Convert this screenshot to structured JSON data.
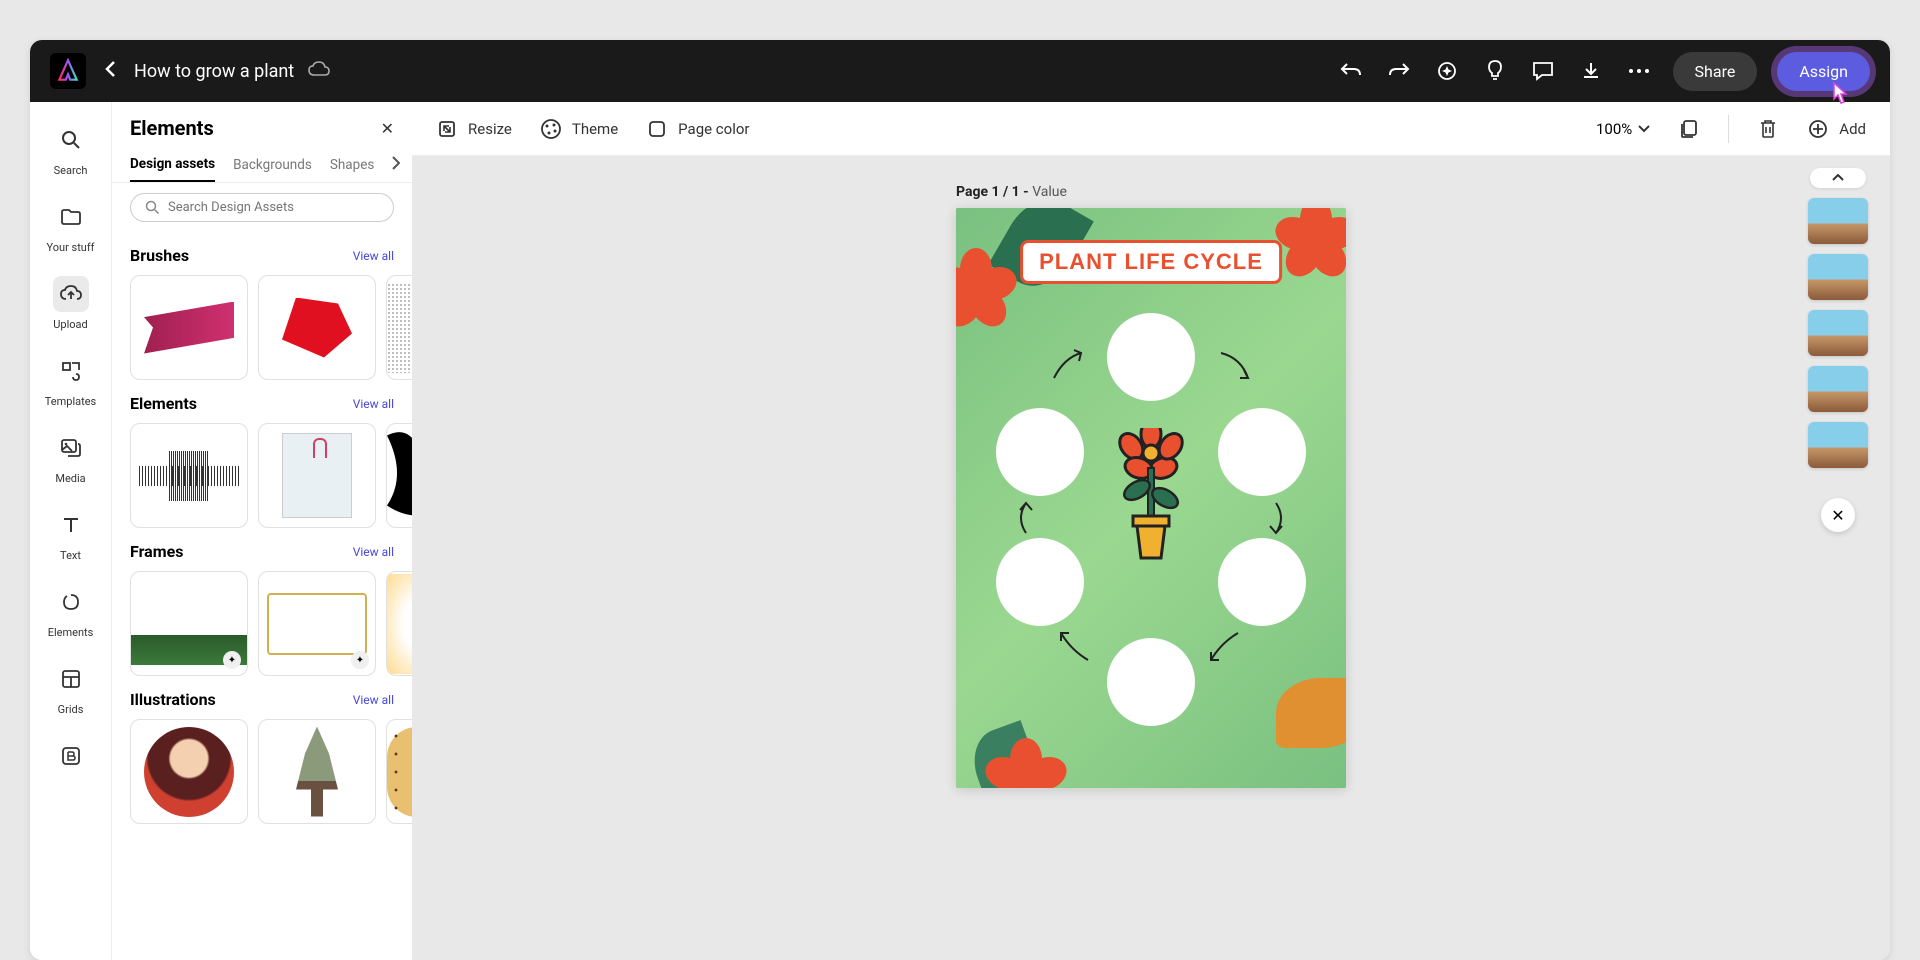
{
  "header": {
    "document_title": "How to grow a plant",
    "share_label": "Share",
    "assign_label": "Assign"
  },
  "leftrail": {
    "search": "Search",
    "your_stuff": "Your stuff",
    "upload": "Upload",
    "templates": "Templates",
    "media": "Media",
    "text": "Text",
    "elements": "Elements",
    "grids": "Grids"
  },
  "panel": {
    "title": "Elements",
    "tabs": {
      "design_assets": "Design assets",
      "backgrounds": "Backgrounds",
      "shapes": "Shapes"
    },
    "search_placeholder": "Search Design Assets",
    "view_all": "View all",
    "sections": {
      "brushes": "Brushes",
      "elements": "Elements",
      "frames": "Frames",
      "illustrations": "Illustrations"
    }
  },
  "toolbar": {
    "resize": "Resize",
    "theme": "Theme",
    "page_color": "Page color",
    "zoom": "100%",
    "add": "Add"
  },
  "canvas": {
    "page_label_prefix": "Page 1 / 1 - ",
    "page_label_value": "Value",
    "artboard_title": "PLANT LIFE CYCLE"
  }
}
